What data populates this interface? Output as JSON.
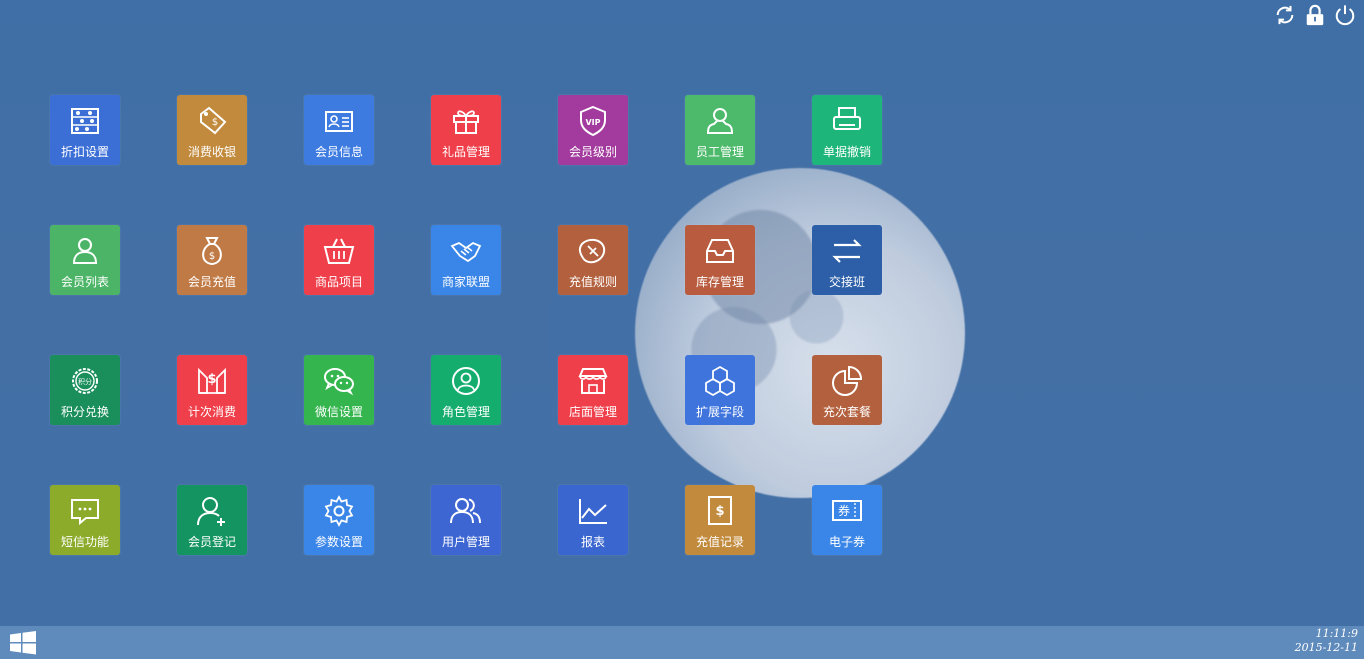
{
  "tiles": [
    {
      "label": "折扣设置",
      "icon": "abacus-icon",
      "color": "#3b6fd6"
    },
    {
      "label": "消费收银",
      "icon": "price-tag-icon",
      "color": "#c28a3c"
    },
    {
      "label": "会员信息",
      "icon": "id-card-icon",
      "color": "#3d7be0"
    },
    {
      "label": "礼品管理",
      "icon": "gift-icon",
      "color": "#ef3f4a"
    },
    {
      "label": "会员级别",
      "icon": "vip-shield-icon",
      "color": "#a23b9d"
    },
    {
      "label": "员工管理",
      "icon": "employee-icon",
      "color": "#4cba6a"
    },
    {
      "label": "单据撤销",
      "icon": "printer-icon",
      "color": "#1eb57a"
    },
    {
      "label": "会员列表",
      "icon": "member-list-icon",
      "color": "#4bb466"
    },
    {
      "label": "会员充值",
      "icon": "money-bag-icon",
      "color": "#c07a45"
    },
    {
      "label": "商品项目",
      "icon": "basket-icon",
      "color": "#ef3f4a"
    },
    {
      "label": "商家联盟",
      "icon": "handshake-icon",
      "color": "#3a86e8"
    },
    {
      "label": "充值规则",
      "icon": "rule-leaf-icon",
      "color": "#b3603e"
    },
    {
      "label": "库存管理",
      "icon": "inbox-icon",
      "color": "#b85b3e"
    },
    {
      "label": "交接班",
      "icon": "swap-arrows-icon",
      "color": "#2c5fa8"
    },
    {
      "label": "积分兑换",
      "icon": "points-badge-icon",
      "color": "#1a8f5c"
    },
    {
      "label": "计次消费",
      "icon": "count-consume-icon",
      "color": "#ef3f4a"
    },
    {
      "label": "微信设置",
      "icon": "wechat-icon",
      "color": "#34b54e"
    },
    {
      "label": "角色管理",
      "icon": "role-icon",
      "color": "#14ad6e"
    },
    {
      "label": "店面管理",
      "icon": "storefront-icon",
      "color": "#ef3f4a"
    },
    {
      "label": "扩展字段",
      "icon": "cubes-icon",
      "color": "#3f74dc"
    },
    {
      "label": "充次套餐",
      "icon": "pie-chart-icon",
      "color": "#b3603e"
    },
    {
      "label": "短信功能",
      "icon": "sms-bubble-icon",
      "color": "#8cab2a"
    },
    {
      "label": "会员登记",
      "icon": "add-user-icon",
      "color": "#139460"
    },
    {
      "label": "参数设置",
      "icon": "gear-icon",
      "color": "#3a86e8"
    },
    {
      "label": "用户管理",
      "icon": "users-icon",
      "color": "#3d66d2"
    },
    {
      "label": "报表",
      "icon": "line-chart-icon",
      "color": "#3a66cf"
    },
    {
      "label": "充值记录",
      "icon": "recharge-record-icon",
      "color": "#c28a3c"
    },
    {
      "label": "电子券",
      "icon": "coupon-icon",
      "color": "#3a86e8"
    }
  ],
  "coupon_glyph": "券",
  "points_glyph": "积分",
  "dollar_glyph": "$",
  "vip_glyph": "VIP",
  "clock": {
    "time": "11:11:9",
    "date": "2015-12-11"
  },
  "top_icons": [
    "refresh-icon",
    "lock-icon",
    "power-icon"
  ]
}
